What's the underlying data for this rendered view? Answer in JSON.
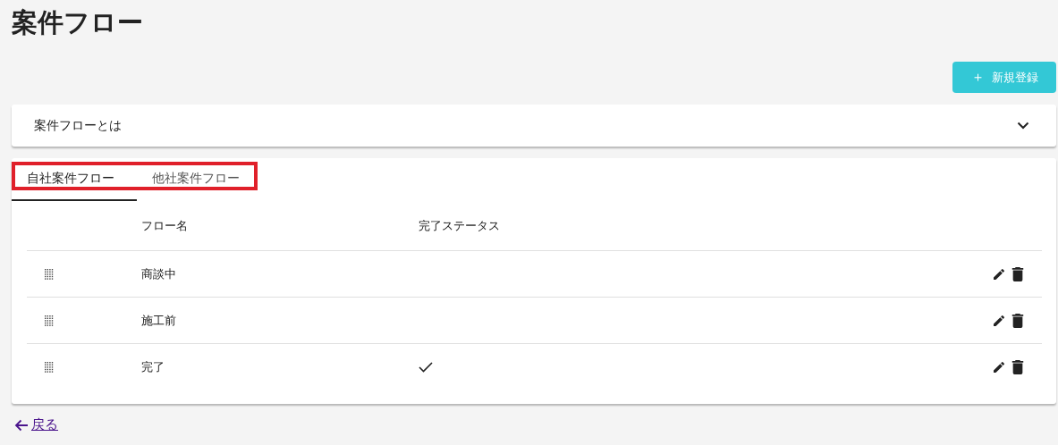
{
  "page": {
    "title": "案件フロー"
  },
  "new_button": {
    "icon": "＋",
    "label": "新規登録"
  },
  "accordion": {
    "title": "案件フローとは",
    "expanded": false
  },
  "tabs": [
    {
      "label": "自社案件フロー",
      "selected": true
    },
    {
      "label": "他社案件フロー",
      "selected": false
    }
  ],
  "table": {
    "columns": [
      "フロー名",
      "完了ステータス"
    ],
    "rows": [
      {
        "name": "商談中",
        "completed": false
      },
      {
        "name": "施工前",
        "completed": false
      },
      {
        "name": "完了",
        "completed": true
      }
    ]
  },
  "back_link": {
    "label": "戻る"
  }
}
